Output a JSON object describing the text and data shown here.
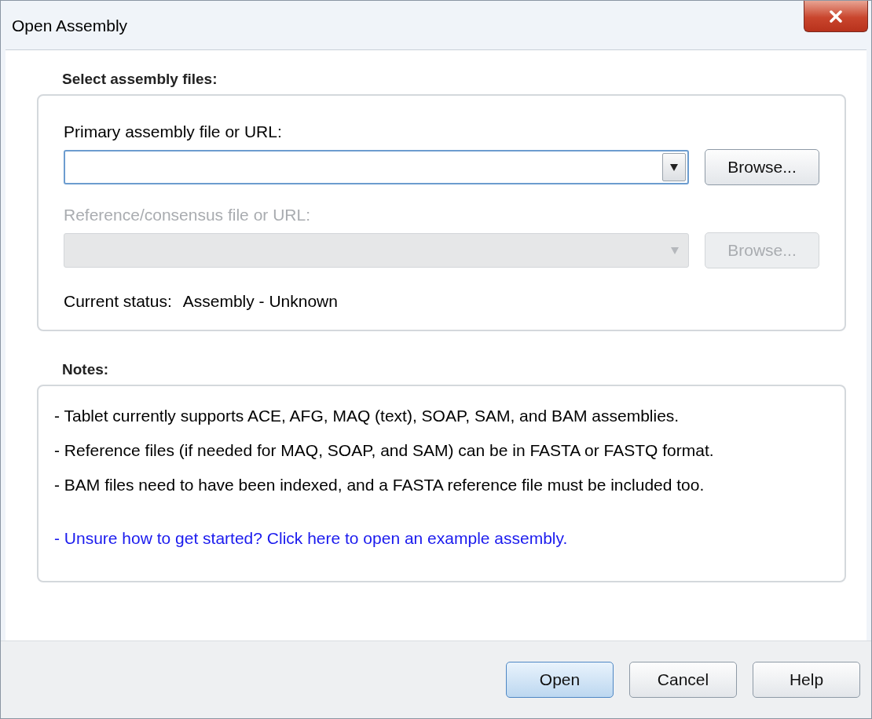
{
  "window": {
    "title": "Open Assembly"
  },
  "files_group": {
    "label": "Select assembly files:",
    "primary": {
      "label": "Primary assembly file or URL:",
      "disabled": false,
      "focused": true,
      "browse": "Browse..."
    },
    "reference": {
      "label": "Reference/consensus file or URL:",
      "disabled": true,
      "focused": false,
      "browse": "Browse..."
    },
    "status": {
      "label": "Current status:",
      "value": "Assembly - Unknown"
    }
  },
  "notes": {
    "label": "Notes:",
    "lines": [
      {
        "kind": "text",
        "text": "- Tablet currently supports ACE, AFG, MAQ (text), SOAP, SAM, and BAM assemblies."
      },
      {
        "kind": "text",
        "text": "- Reference files (if needed for MAQ, SOAP, and SAM) can be in FASTA or FASTQ format."
      },
      {
        "kind": "text",
        "text": "- BAM files need to have been indexed, and a FASTA reference file must be included too."
      },
      {
        "kind": "link",
        "text": "- Unsure how to get started? Click here to open an example assembly."
      }
    ]
  },
  "buttons": [
    {
      "label": "Open",
      "default": true
    },
    {
      "label": "Cancel",
      "default": false
    },
    {
      "label": "Help",
      "default": false
    }
  ]
}
